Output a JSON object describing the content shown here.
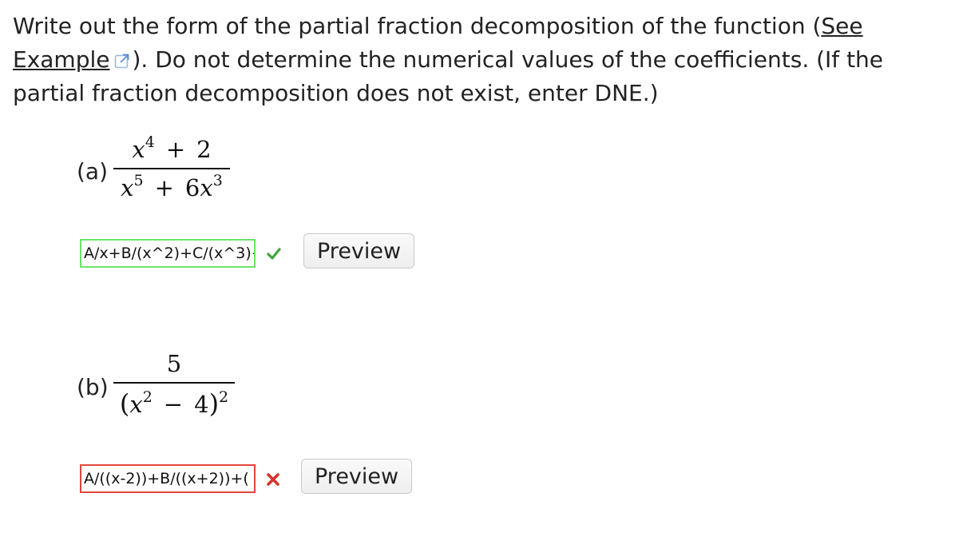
{
  "prompt": {
    "text_before_link": "Write out the form of the partial fraction decomposition of the function (",
    "link_label": "See Example",
    "link_icon": "external-link-icon",
    "text_after_link": "). Do not determine the numerical values of the coefficients. (If the partial fraction decomposition does not exist, enter DNE.)"
  },
  "parts": [
    {
      "label": "(a)",
      "numerator": {
        "base": "x",
        "exp": "4",
        "op": "+",
        "const": "2"
      },
      "denominator": {
        "t1_base": "x",
        "t1_exp": "5",
        "op": "+",
        "t2_coef": "6",
        "t2_base": "x",
        "t2_exp": "3"
      },
      "answer_value": "A/x+B/(x^2)+C/(x^3)+",
      "status": "correct",
      "status_icon": "checkmark-icon",
      "status_color": "#3fa43b",
      "preview_label": "Preview"
    },
    {
      "label": "(b)",
      "numerator": {
        "value": "5"
      },
      "denominator": {
        "open": "(",
        "base": "x",
        "exp": "2",
        "op": "−",
        "const": "4",
        "close": ")",
        "outer_exp": "2"
      },
      "answer_value": "A/((x-2))+B/((x+2))+(",
      "status": "incorrect",
      "status_icon": "cross-icon",
      "status_color": "#d9322a",
      "preview_label": "Preview"
    }
  ],
  "colors": {
    "correct_border": "#6ce36a",
    "incorrect_border": "#e2463a",
    "link_icon": "#5a8fd0"
  }
}
